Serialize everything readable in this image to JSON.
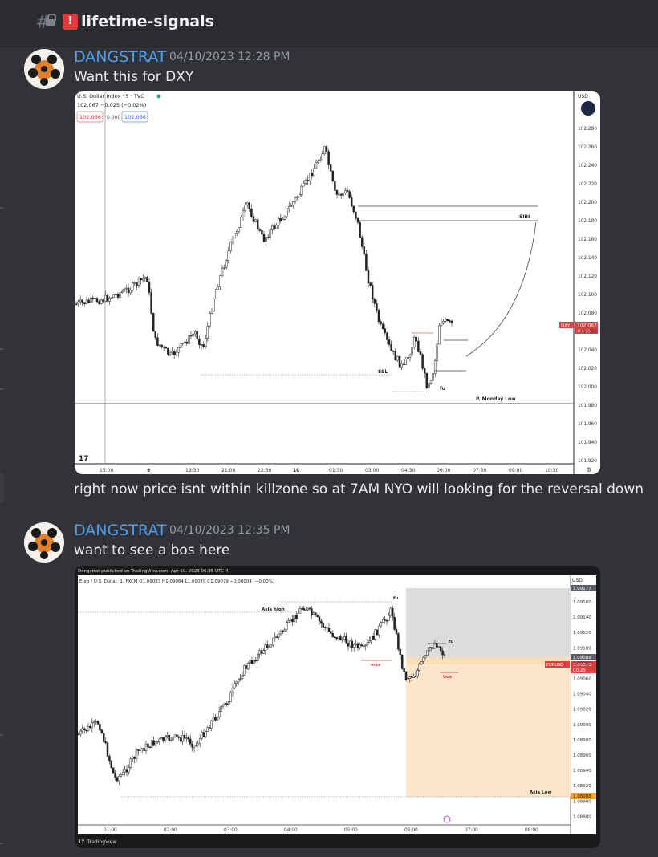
{
  "channel": {
    "name": "lifetime-signals",
    "emoji": "!"
  },
  "messages": [
    {
      "author": "DANGSTRAT",
      "timestamp": "04/10/2023 12:28 PM",
      "text": "Want this for DXY",
      "after_text": "right now price isnt within killzone so at 7AM NYO will looking for the reversal down"
    },
    {
      "author": "DANGSTRAT",
      "timestamp": "04/10/2023 12:35 PM",
      "text": "want to see a bos here"
    }
  ],
  "chart1": {
    "header": "U.S. Dollar Index · 5 · TVC",
    "quote": "102.067  −0.025 (−0.02%)",
    "bid": "102.066",
    "spread": "0.000",
    "ask": "102.066",
    "currency": "USD",
    "symbol_tag": "DXY",
    "price_tag": "102.067",
    "countdown": "03:50",
    "price_labels": [
      "102.280",
      "102.260",
      "102.240",
      "102.220",
      "102.200",
      "102.180",
      "102.160",
      "102.140",
      "102.120",
      "102.100",
      "102.080",
      "102.060",
      "102.040",
      "102.020",
      "102.000",
      "101.980",
      "101.960",
      "101.940",
      "101.920"
    ],
    "time_labels": [
      "15:00",
      "9",
      "19:30",
      "21:00",
      "22:30",
      "10",
      "01:30",
      "03:00",
      "04:30",
      "06:00",
      "07:30",
      "09:00",
      "10:30"
    ],
    "annotations": {
      "sibi": "SIBI",
      "ssl": "SSL",
      "fu": "fu",
      "monday_low": "P. Monday Low"
    },
    "logo": "17"
  },
  "chart2": {
    "published": "Dangstrat published on TradingView.com, Apr 10, 2023 06:35 UTC-4",
    "header": "Euro / U.S. Dollar, 1, FXCM  O1.09083  H1.09084  L1.09079  C1.09079  −0.00004 (−0.00%)",
    "currency": "USD",
    "symbol_tag": "EURUSD",
    "price_tag": "1.09079",
    "countdown": "00:25",
    "top_tag": "1.09177",
    "zone_tag": "1.09089",
    "low_tag": "1.08908",
    "price_labels": [
      "1.09160",
      "1.09140",
      "1.09120",
      "1.09100",
      "1.09080",
      "1.09060",
      "1.09040",
      "1.09020",
      "1.09000",
      "1.08980",
      "1.08960",
      "1.08940",
      "1.08920",
      "1.08900",
      "1.08880"
    ],
    "time_labels": [
      "01:00",
      "02:00",
      "03:00",
      "04:00",
      "05:00",
      "06:00",
      "07:00",
      "08:00"
    ],
    "annotations": {
      "asia_high": "Asia high",
      "fu_left": "fu",
      "mss": "mss",
      "fu_right": "fu",
      "bos": "bos",
      "asia_low": "Asia Low"
    },
    "footer": "TradingView",
    "logo": "17"
  }
}
